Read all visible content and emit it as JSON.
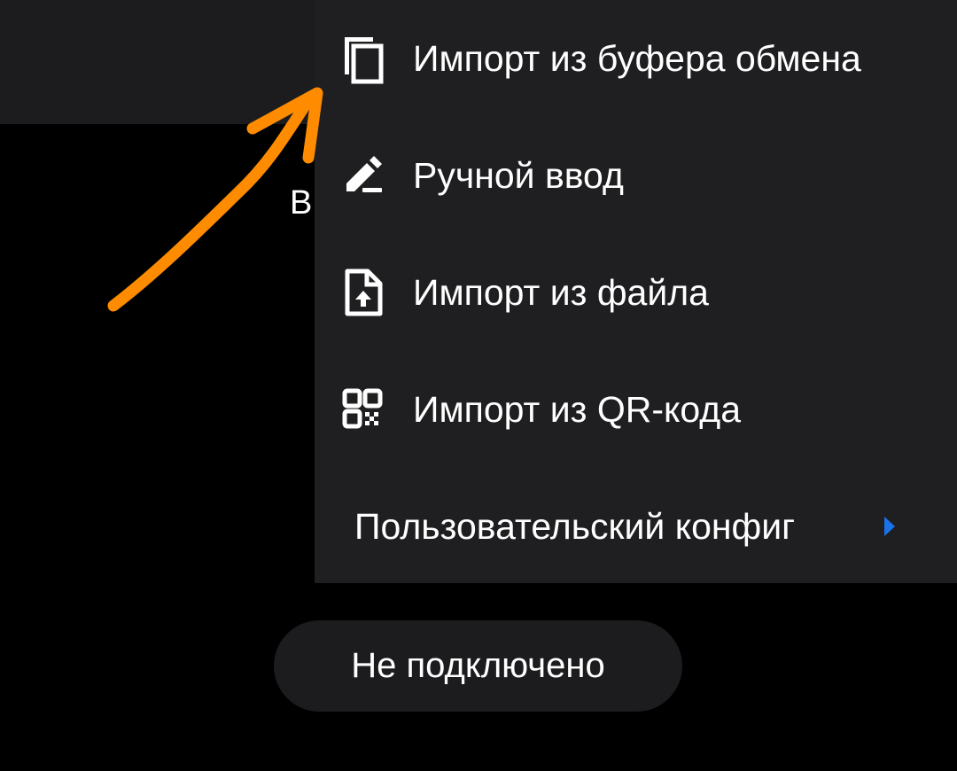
{
  "app_bar": {},
  "background": {
    "partial_text": "В"
  },
  "menu": {
    "items": [
      {
        "label": "Импорт из буфера обмена",
        "icon": "copy-icon"
      },
      {
        "label": "Ручной ввод",
        "icon": "edit-pencil-icon"
      },
      {
        "label": "Импорт из файла",
        "icon": "file-upload-icon"
      },
      {
        "label": "Импорт из QR-кода",
        "icon": "qr-code-icon"
      },
      {
        "label": "Пользовательский конфиг",
        "icon": "chevron-right-icon",
        "has_submenu": true
      }
    ]
  },
  "status": {
    "label": "Не подключено"
  },
  "colors": {
    "background": "#000000",
    "app_bar": "#1c1c1e",
    "menu_background": "#1f1f21",
    "text": "#ffffff",
    "submenu_arrow": "#1a73e8",
    "annotation_arrow": "#ff8c00"
  },
  "annotation": {
    "icon": "hand-drawn-arrow-icon"
  }
}
